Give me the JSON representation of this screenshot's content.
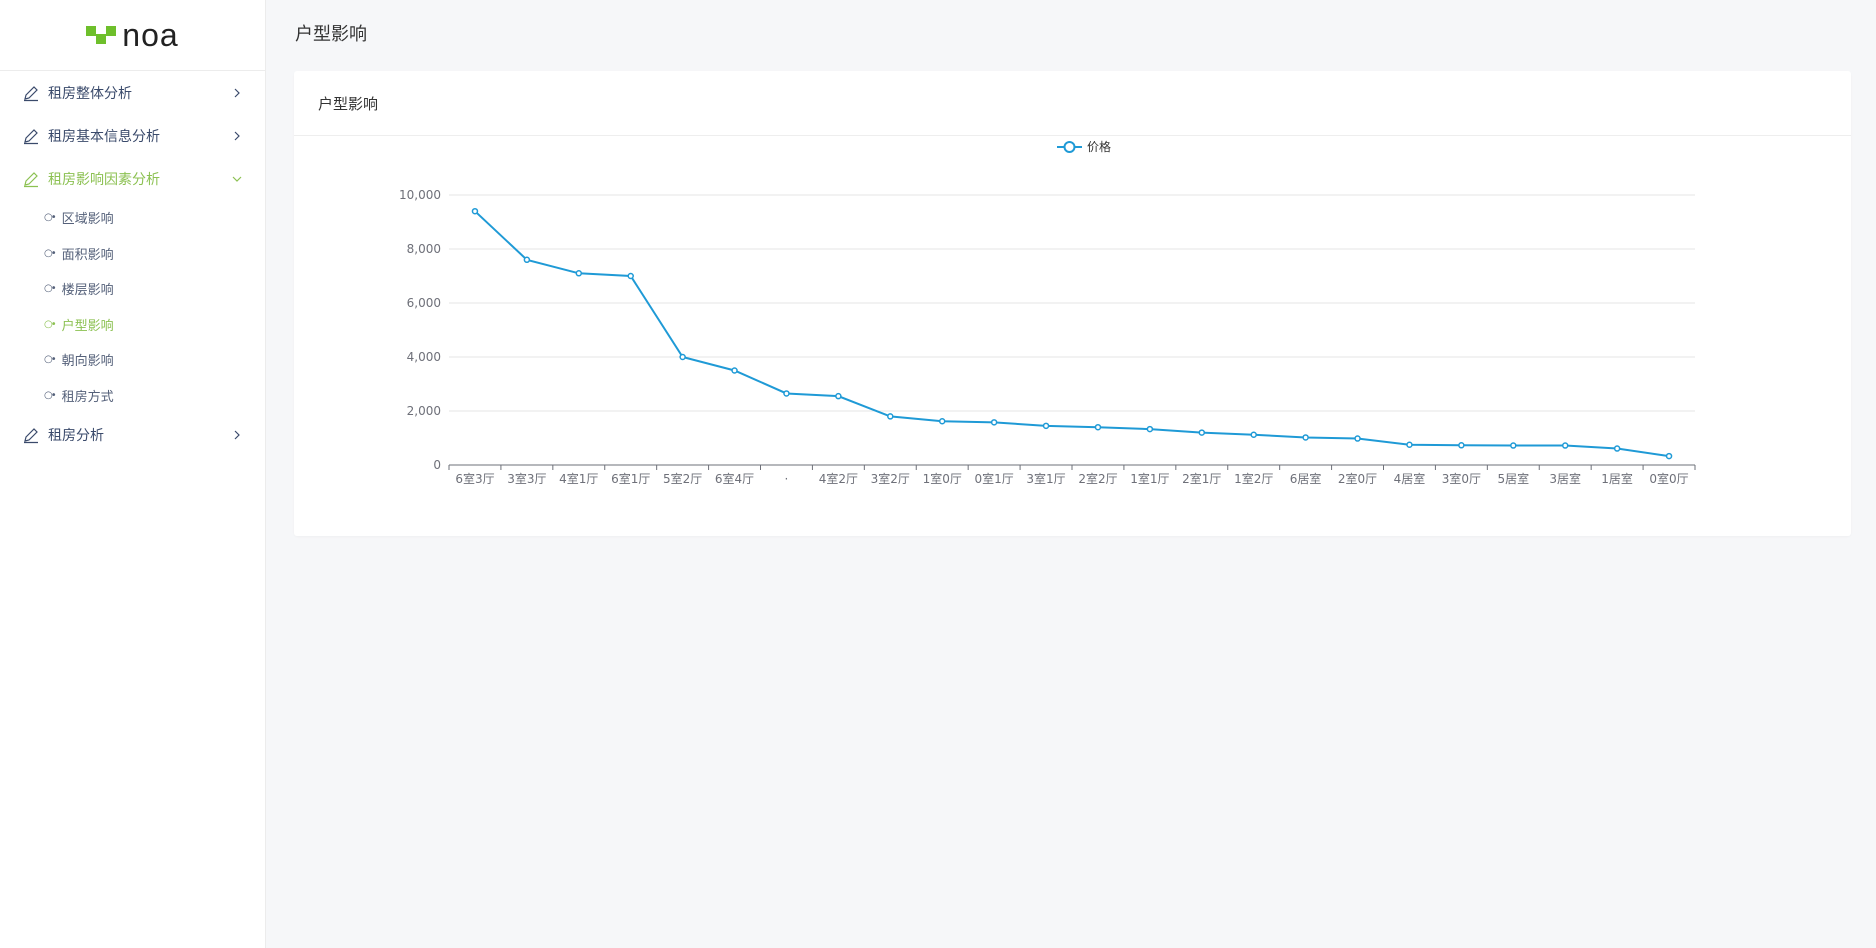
{
  "logo": {
    "text": "noa"
  },
  "sidebar": {
    "items": [
      {
        "label": "租房整体分析",
        "expanded": false,
        "active": false
      },
      {
        "label": "租房基本信息分析",
        "expanded": false,
        "active": false
      },
      {
        "label": "租房影响因素分析",
        "expanded": true,
        "active": true,
        "children": [
          {
            "label": "区域影响",
            "active": false
          },
          {
            "label": "面积影响",
            "active": false
          },
          {
            "label": "楼层影响",
            "active": false
          },
          {
            "label": "户型影响",
            "active": true
          },
          {
            "label": "朝向影响",
            "active": false
          },
          {
            "label": "租房方式",
            "active": false
          }
        ]
      },
      {
        "label": "租房分析",
        "expanded": false,
        "active": false
      }
    ],
    "sub_bullet": "○•",
    "colors": {
      "active": "#8cc152",
      "default": "#3a4a6b"
    }
  },
  "page": {
    "title": "户型影响"
  },
  "card": {
    "title": "户型影响"
  },
  "chart_data": {
    "type": "line",
    "legend": [
      "价格"
    ],
    "legend_position": "top-center",
    "color": "#1f9ad6",
    "categories": [
      "6室3厅",
      "3室3厅",
      "4室1厅",
      "6室1厅",
      "5室2厅",
      "6室4厅",
      "·",
      "4室2厅",
      "3室2厅",
      "1室0厅",
      "0室1厅",
      "3室1厅",
      "2室2厅",
      "1室1厅",
      "2室1厅",
      "1室2厅",
      "6居室",
      "2室0厅",
      "4居室",
      "3室0厅",
      "5居室",
      "3居室",
      "1居室",
      "0室0厅"
    ],
    "series": [
      {
        "name": "价格",
        "values": [
          9400,
          7600,
          7100,
          7000,
          4000,
          3500,
          2650,
          2550,
          1800,
          1620,
          1580,
          1450,
          1400,
          1330,
          1200,
          1120,
          1020,
          980,
          750,
          730,
          720,
          720,
          610,
          330
        ]
      }
    ],
    "ylim": [
      0,
      10000
    ],
    "yticks": [
      "0",
      "2,000",
      "4,000",
      "6,000",
      "8,000",
      "10,000"
    ],
    "grid": true
  }
}
